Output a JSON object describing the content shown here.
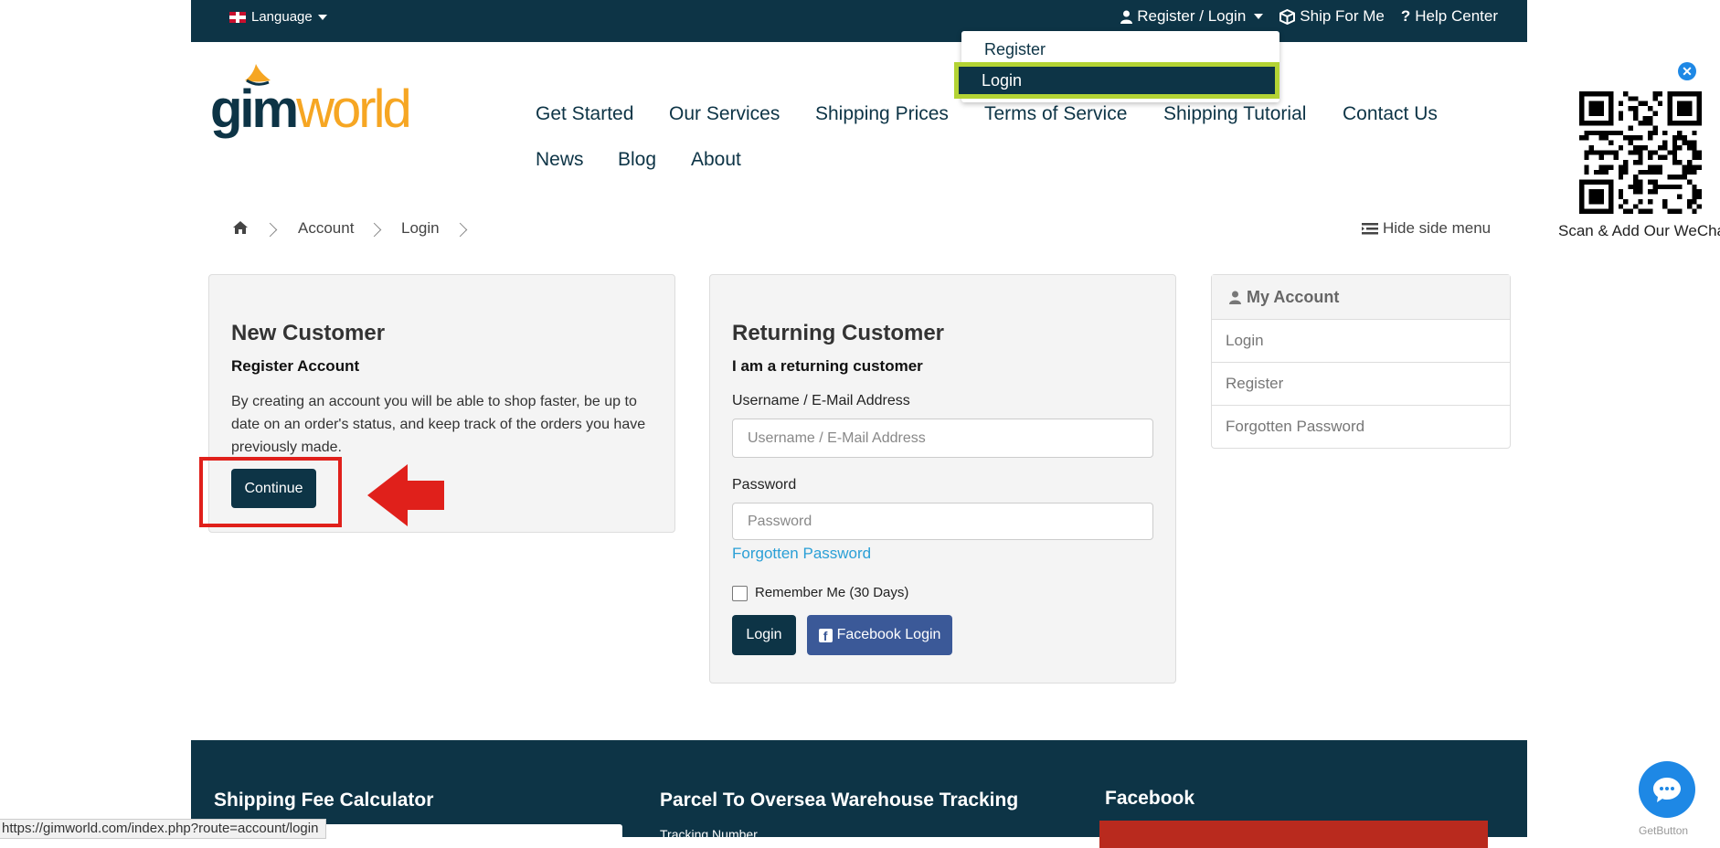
{
  "topbar": {
    "language_label": "Language",
    "account_label": "Register / Login",
    "ship_for_me": "Ship For Me",
    "help_center": "Help Center"
  },
  "account_dropdown": {
    "register": "Register",
    "login": "Login"
  },
  "logo": {
    "part1": "gim",
    "part2": "world"
  },
  "nav": {
    "items": [
      "Get Started",
      "Our Services",
      "Shipping Prices",
      "Terms of Service",
      "Shipping Tutorial",
      "Contact Us",
      "News",
      "Blog",
      "About"
    ]
  },
  "qr": {
    "caption": "Scan & Add Our WeChat"
  },
  "breadcrumb": {
    "items": [
      "Account",
      "Login"
    ],
    "hide_side_menu": "Hide side menu"
  },
  "new_customer": {
    "title": "New Customer",
    "subtitle": "Register Account",
    "description": "By creating an account you will be able to shop faster, be up to date on an order's status, and keep track of the orders you have previously made.",
    "continue_label": "Continue"
  },
  "returning_customer": {
    "title": "Returning Customer",
    "subtitle": "I am a returning customer",
    "username_label": "Username / E-Mail Address",
    "username_placeholder": "Username / E-Mail Address",
    "password_label": "Password",
    "password_placeholder": "Password",
    "forgotten_link": "Forgotten Password",
    "remember_label": "Remember Me (30 Days)",
    "login_label": "Login",
    "facebook_label": "Facebook Login"
  },
  "side_menu": {
    "title": "My Account",
    "items": [
      "Login",
      "Register",
      "Forgotten Password"
    ]
  },
  "footer": {
    "calculator_title": "Shipping Fee Calculator",
    "tracking_title": "Parcel To Oversea Warehouse Tracking",
    "tracking_label": "Tracking Number",
    "facebook_title": "Facebook"
  },
  "status_url": "https://gimworld.com/index.php?route=account/login",
  "chat": {
    "label": "GetButton"
  },
  "colors": {
    "brand_dark": "#0d3446",
    "brand_orange": "#f6a623",
    "highlight_green": "#b3d334",
    "annotation_red": "#e0201b",
    "link_blue": "#2a9fd6",
    "facebook_blue": "#3b5998"
  }
}
